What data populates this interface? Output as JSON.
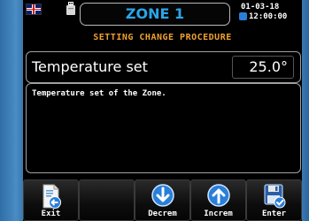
{
  "header": {
    "zone_title": "ZONE 1",
    "date": "01-03-18",
    "time": "12:00:00",
    "language_icon": "uk-flag-icon",
    "usb_icon": "usb-icon",
    "clock_icon": "clock-icon"
  },
  "subtitle": "SETTING CHANGE PROCEDURE",
  "parameter": {
    "label": "Temperature set",
    "value": "25.0°"
  },
  "description": "Temperature set of the Zone.",
  "buttons": [
    {
      "label": "Exit",
      "icon": "exit-icon"
    },
    {
      "label": "",
      "icon": ""
    },
    {
      "label": "",
      "icon": ""
    },
    {
      "label": "Decrem",
      "icon": "arrow-down-icon"
    },
    {
      "label": "Increm",
      "icon": "arrow-up-icon"
    },
    {
      "label": "Enter",
      "icon": "save-icon"
    }
  ],
  "colors": {
    "zone_title": "#2aa6e8",
    "subtitle": "#f0a030",
    "bezel": "#3d7fb8",
    "screen": "#000000"
  }
}
